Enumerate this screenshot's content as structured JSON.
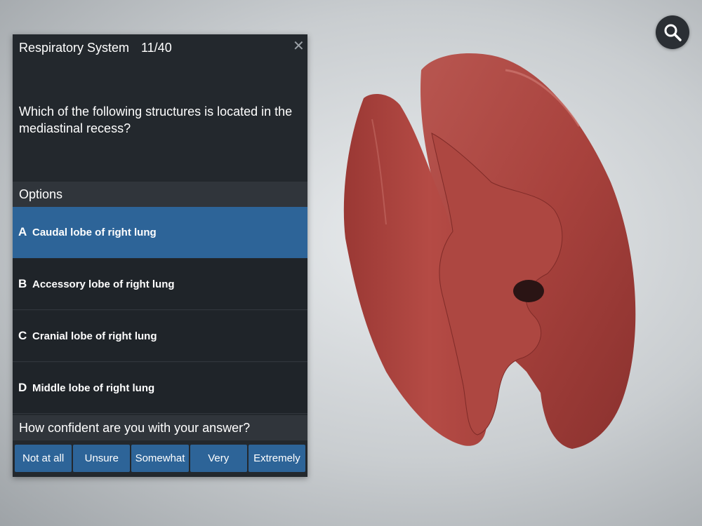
{
  "panel": {
    "title": "Respiratory System",
    "progress": "11/40",
    "close_icon": "close-icon",
    "question": "Which of the following structures is located in the mediastinal recess?",
    "options_header": "Options",
    "options": [
      {
        "letter": "A",
        "text": "Caudal lobe of right lung",
        "selected": true
      },
      {
        "letter": "B",
        "text": "Accessory lobe of right lung",
        "selected": false
      },
      {
        "letter": "C",
        "text": "Cranial lobe of right lung",
        "selected": false
      },
      {
        "letter": "D",
        "text": "Middle lobe of right lung",
        "selected": false
      }
    ],
    "confidence_header": "How confident are you with your answer?",
    "confidence_options": [
      "Not at all",
      "Unsure",
      "Somewhat",
      "Very",
      "Extremely"
    ]
  },
  "viewer": {
    "search_icon": "search-icon",
    "model": "3d-lung-model"
  },
  "colors": {
    "panel_bg": "#23282d",
    "section_bg": "#30353b",
    "selected_accent": "#2d6498",
    "tissue": "#b84a44"
  }
}
